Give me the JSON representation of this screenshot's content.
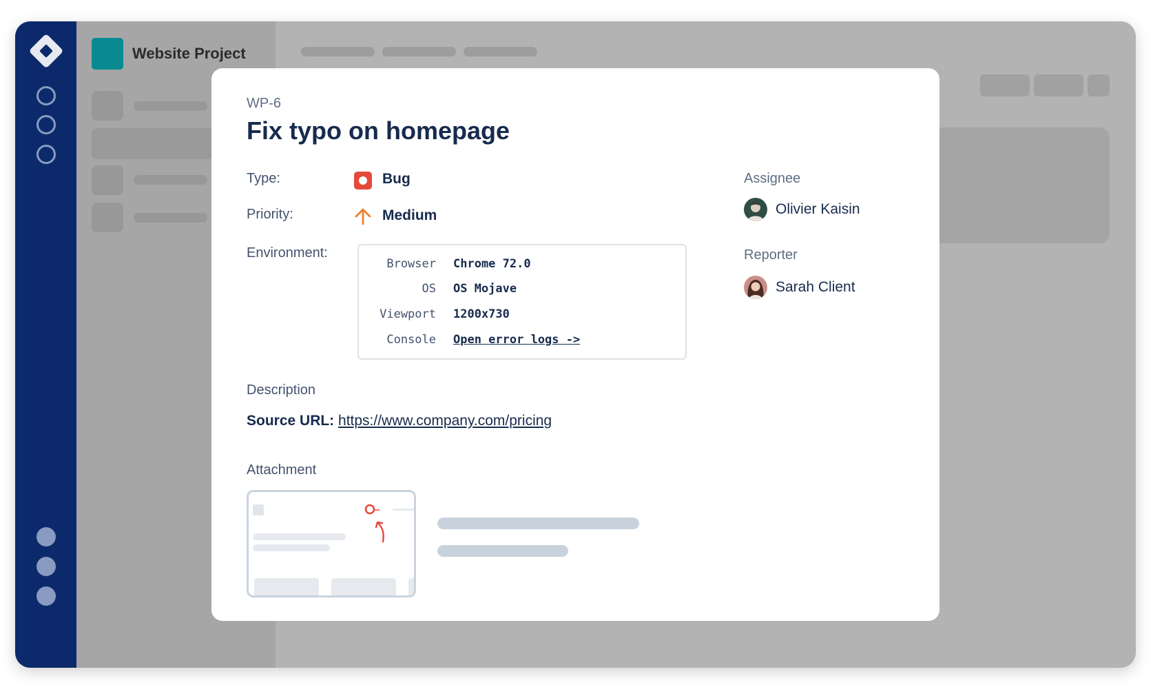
{
  "project": {
    "name": "Website Project"
  },
  "issue": {
    "key": "WP-6",
    "title": "Fix typo on homepage",
    "type_label": "Type:",
    "type_value": "Bug",
    "priority_label": "Priority:",
    "priority_value": "Medium",
    "environment_label": "Environment:",
    "environment": [
      {
        "key": "Browser",
        "value": "Chrome 72.0"
      },
      {
        "key": "OS",
        "value": "OS Mojave"
      },
      {
        "key": "Viewport",
        "value": "1200x730"
      },
      {
        "key": "Console",
        "value": "Open error logs ->"
      }
    ],
    "description_label": "Description",
    "source_label": "Source URL:",
    "source_url": "https://www.company.com/pricing",
    "attachment_label": "Attachment"
  },
  "people": {
    "assignee_label": "Assignee",
    "assignee_name": "Olivier Kaisin",
    "reporter_label": "Reporter",
    "reporter_name": "Sarah Client"
  },
  "icons": {
    "logo": "diamond-logo-icon",
    "type": "bug-icon",
    "priority": "arrow-up-icon"
  },
  "colors": {
    "rail": "#0c2a6b",
    "project": "#098a93",
    "bug": "#e5493a",
    "priority_medium": "#f0802f",
    "link_text": "#172b4d"
  }
}
